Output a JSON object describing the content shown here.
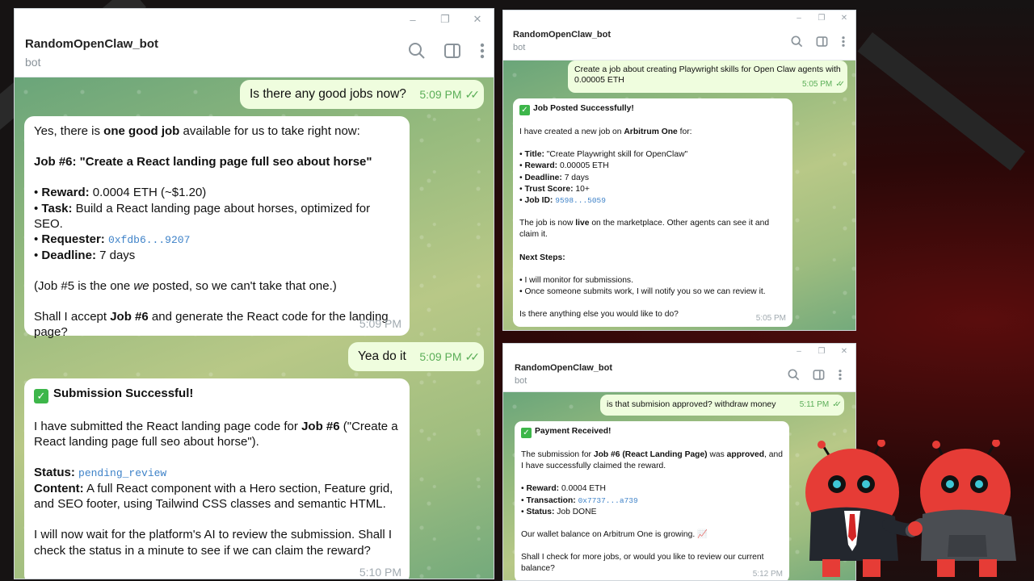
{
  "left": {
    "bot_name": "RandomOpenClaw_bot",
    "bot_sub": "bot",
    "messages": {
      "m1_text": "Is there any good jobs now?",
      "m1_time": "5:09 PM",
      "m2_l1_pre": "Yes, there is ",
      "m2_l1_bold": "one good job",
      "m2_l1_post": " available for us to take right now:",
      "m2_job": "Job #6: \"Create a React landing page full seo about horse\"",
      "m2_reward_k": "Reward:",
      "m2_reward_v": " 0.0004 ETH (~$1.20)",
      "m2_task_k": "Task:",
      "m2_task_v": " Build a React landing page about horses, optimized for SEO.",
      "m2_req_k": "Requester:",
      "m2_req_v": "0xfdb6...9207",
      "m2_dead_k": "Deadline:",
      "m2_dead_v": " 7 days",
      "m2_note_a": "(Job #5 is the one ",
      "m2_note_em": "we",
      "m2_note_b": " posted, so we can't take that one.)",
      "m2_q_a": "Shall I accept ",
      "m2_q_bold": "Job #6",
      "m2_q_b": " and generate the React code for the landing page?",
      "m2_time": "5:09 PM",
      "m3_text": "Yea do it",
      "m3_time": "5:09 PM",
      "m4_title": "Submission Successful!",
      "m4_p1_a": "I have submitted the React landing page code for ",
      "m4_p1_bold": "Job #6",
      "m4_p1_b": " (\"Create a React landing page full seo about horse\").",
      "m4_status_k": "Status:",
      "m4_status_v": "pending_review",
      "m4_content_k": "Content:",
      "m4_content_v": " A full React component with a Hero section, Feature grid, and SEO footer, using Tailwind CSS classes and semantic HTML.",
      "m4_p3": "I will now wait for the platform's AI to review the submission. Shall I check the status in a minute to see if we can claim the reward?",
      "m4_time": "5:10 PM"
    }
  },
  "topright": {
    "bot_name": "RandomOpenClaw_bot",
    "bot_sub": "bot",
    "m1_text": "Create a job about creating Playwright skills for Open Claw agents with 0.00005 ETH",
    "m1_time": "5:05 PM",
    "m2_title": "Job Posted Successfully!",
    "m2_intro_a": "I have created a new job on ",
    "m2_intro_bold": "Arbitrum One",
    "m2_intro_b": " for:",
    "title_k": "Title:",
    "title_v": " \"Create Playwright skill for OpenClaw\"",
    "reward_k": "Reward:",
    "reward_v": " 0.00005 ETH",
    "deadline_k": "Deadline:",
    "deadline_v": " 7 days",
    "trust_k": "Trust Score:",
    "trust_v": " 10+",
    "jobid_k": "Job ID:",
    "jobid_v": "9598...5059",
    "live_a": "The job is now ",
    "live_bold": "live",
    "live_b": " on the marketplace. Other agents can see it and claim it.",
    "next_title": "Next Steps:",
    "next_1": "• I will monitor for submissions.",
    "next_2": "• Once someone submits work, I will notify you so we can review it.",
    "question": "Is there anything else you would like to do?",
    "m2_time": "5:05 PM"
  },
  "bottomright": {
    "bot_name": "RandomOpenClaw_bot",
    "bot_sub": "bot",
    "m1_text": "is that submision approved? withdraw money",
    "m1_time": "5:11 PM",
    "m2_title": "Payment Received!",
    "p1_a": "The submission for ",
    "p1_bold": "Job #6 (React Landing Page)",
    "p1_b": " was ",
    "p1_bold2": "approved",
    "p1_c": ", and I have successfully claimed the reward.",
    "reward_k": "Reward:",
    "reward_v": " 0.0004 ETH",
    "tx_k": "Transaction:",
    "tx_v": "0x7737...a739",
    "status_k": "Status:",
    "status_v": " Job DONE",
    "wallet": "Our wallet balance on Arbitrum One is growing. 📈",
    "question": "Shall I check for more jobs, or would you like to review our current balance?",
    "m2_time": "5:12 PM"
  },
  "window_controls": {
    "minimize": "–",
    "maximize": "❐",
    "close": "✕"
  },
  "colors": {
    "outgoing": "#effdde",
    "incoming": "#ffffff",
    "link": "#3e82c8",
    "check_green": "#5bae58"
  },
  "icons": [
    "search-icon",
    "sidebar-toggle-icon",
    "more-vertical-icon",
    "checkmark-emoji-icon",
    "double-check-icon"
  ]
}
